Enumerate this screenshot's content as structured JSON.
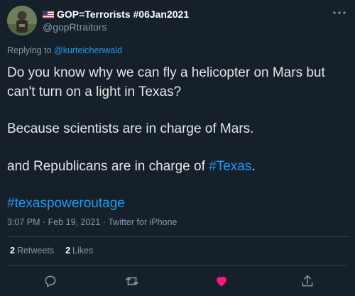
{
  "author": {
    "display_name": "GOP=Terrorists #06Jan2021",
    "handle": "@gopRtraitors"
  },
  "reply": {
    "prefix": "Replying to",
    "mention": "@kurteichenwald"
  },
  "body": {
    "line1": "Do you know why we can fly a helicopter on Mars but can't turn on a light in Texas?",
    "line2": "Because scientists are in charge of Mars.",
    "line3_prefix": "and Republicans are in charge of ",
    "line3_hashtag": "#Texas",
    "line3_suffix": ".",
    "hashtag_line": "#texaspoweroutage"
  },
  "meta": {
    "time": "3:07 PM",
    "date": "Feb 19, 2021",
    "client": "Twitter for iPhone",
    "separator": " · "
  },
  "stats": {
    "retweets_count": "2",
    "retweets_label": "Retweets",
    "likes_count": "2",
    "likes_label": "Likes"
  },
  "actions": {
    "reply_icon": "reply-icon",
    "retweet_icon": "retweet-icon",
    "like_icon": "heart-icon",
    "share_icon": "share-icon"
  },
  "colors": {
    "background": "#15202b",
    "accent": "#1d9bf0",
    "like": "#f91880",
    "muted": "#8899a6"
  }
}
